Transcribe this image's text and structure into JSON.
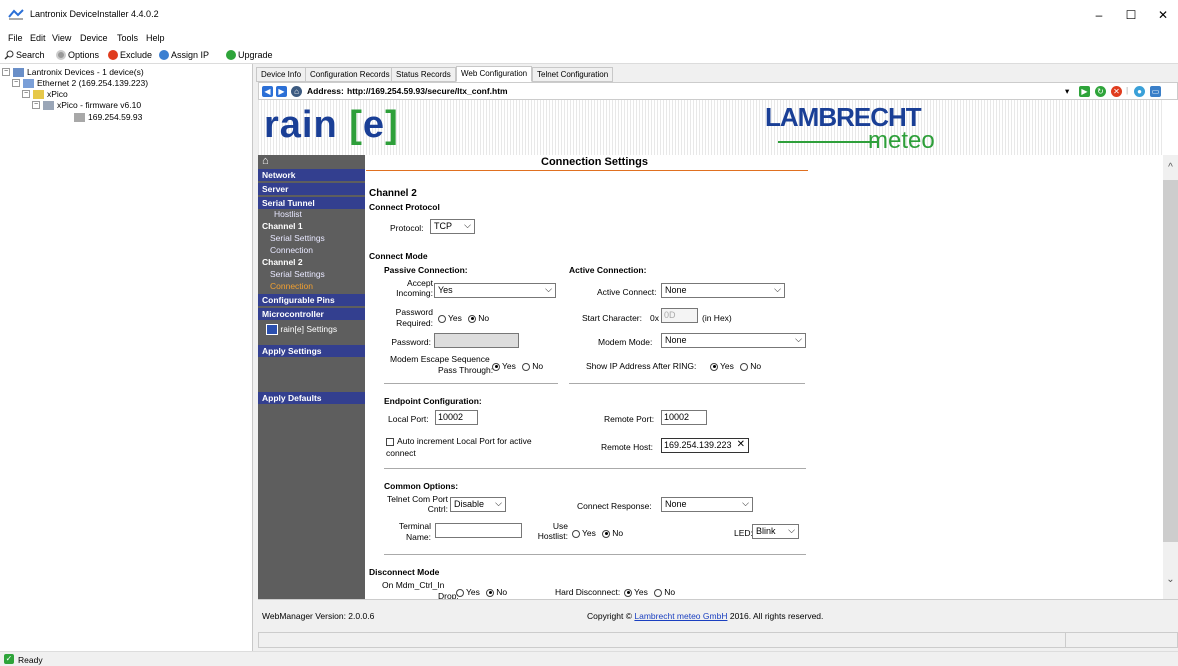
{
  "window": {
    "title": "Lantronix DeviceInstaller 4.4.0.2",
    "min": "–",
    "max": "☐",
    "close": "✕"
  },
  "menu": [
    "File",
    "Edit",
    "View",
    "Device",
    "Tools",
    "Help"
  ],
  "toolbar": {
    "search": "Search",
    "options": "Options",
    "exclude": "Exclude",
    "assign_ip": "Assign IP",
    "upgrade": "Upgrade"
  },
  "tree": {
    "root": "Lantronix Devices - 1 device(s)",
    "ethernet": "Ethernet 2 (169.254.139.223)",
    "xpico": "xPico",
    "firmware": "xPico - firmware v6.10",
    "ip": "169.254.59.93"
  },
  "tabs": [
    "Device Info",
    "Configuration Records",
    "Status Records",
    "Web Configuration",
    "Telnet Configuration"
  ],
  "address": {
    "label": "Address:",
    "url": "http://169.254.59.93/secure/ltx_conf.htm"
  },
  "banner": {
    "rain": "rain",
    "e_open": "[",
    "e": "e",
    "e_close": "]",
    "lambrecht": "LAMBRECHT",
    "meteo": "meteo"
  },
  "nav": {
    "home": "⌂",
    "network": "Network",
    "server": "Server",
    "serial_tunnel": "Serial Tunnel",
    "hostlist": "Hostlist",
    "channel1": "Channel 1",
    "ch1_serial": "Serial Settings",
    "ch1_conn": "Connection",
    "channel2": "Channel 2",
    "ch2_serial": "Serial Settings",
    "ch2_conn": "Connection",
    "config_pins": "Configurable Pins",
    "microcontroller": "Microcontroller",
    "rain_settings": "rain[e] Settings",
    "apply_settings": "Apply Settings",
    "apply_defaults": "Apply Defaults"
  },
  "form": {
    "title": "Connection Settings",
    "channel": "Channel 2",
    "connect_protocol": "Connect Protocol",
    "protocol_label": "Protocol:",
    "protocol_value": "TCP",
    "connect_mode": "Connect Mode",
    "passive_hdr": "Passive Connection:",
    "active_hdr": "Active Connection:",
    "accept_label_1": "Accept",
    "accept_label_2": "Incoming:",
    "accept_value": "Yes",
    "active_connect_label": "Active Connect:",
    "active_connect_value": "None",
    "pwreq_label_1": "Password",
    "pwreq_label_2": "Required:",
    "yes": "Yes",
    "no": "No",
    "start_char_label": "Start Character:",
    "start_char_prefix": "0x",
    "start_char_value": "0D",
    "in_hex": "(in Hex)",
    "password_label": "Password:",
    "modem_mode_label": "Modem Mode:",
    "modem_mode_value": "None",
    "modem_escape_1": "Modem Escape Sequence",
    "modem_escape_2": "Pass Through:",
    "show_ip_label": "Show IP Address After RING:",
    "endpoint_hdr": "Endpoint Configuration:",
    "local_port_label": "Local Port:",
    "local_port_value": "10002",
    "remote_port_label": "Remote Port:",
    "remote_port_value": "10002",
    "auto_inc_1": "Auto increment Local Port for active",
    "auto_inc_2": "connect",
    "remote_host_label": "Remote Host:",
    "remote_host_value": "169.254.139.223",
    "common_hdr": "Common Options:",
    "telnet_1": "Telnet Com Port",
    "telnet_2": "Cntrl:",
    "telnet_value": "Disable",
    "connect_resp_label": "Connect Response:",
    "connect_resp_value": "None",
    "terminal_1": "Terminal",
    "terminal_2": "Name:",
    "use_hostlist_1": "Use",
    "use_hostlist_2": "Hostlist:",
    "led_label": "LED:",
    "led_value": "Blink",
    "disconnect_hdr": "Disconnect Mode",
    "mdm_ctrl_1": "On Mdm_Ctrl_In",
    "mdm_ctrl_2": "Drop:",
    "hard_disc_label": "Hard Disconnect:"
  },
  "footer": {
    "version": "WebManager Version: 2.0.0.6",
    "copyright_pre": "Copyright ©",
    "copyright_link": "Lambrecht meteo GmbH",
    "copyright_post": "2016. All rights reserved."
  },
  "status": "Ready",
  "colors": {
    "nav_header": "#333f8f",
    "nav_bg": "#5e5e5e",
    "accent_orange": "#e07020",
    "brand_blue": "#1a3f96",
    "brand_green": "#2e9f3a"
  }
}
